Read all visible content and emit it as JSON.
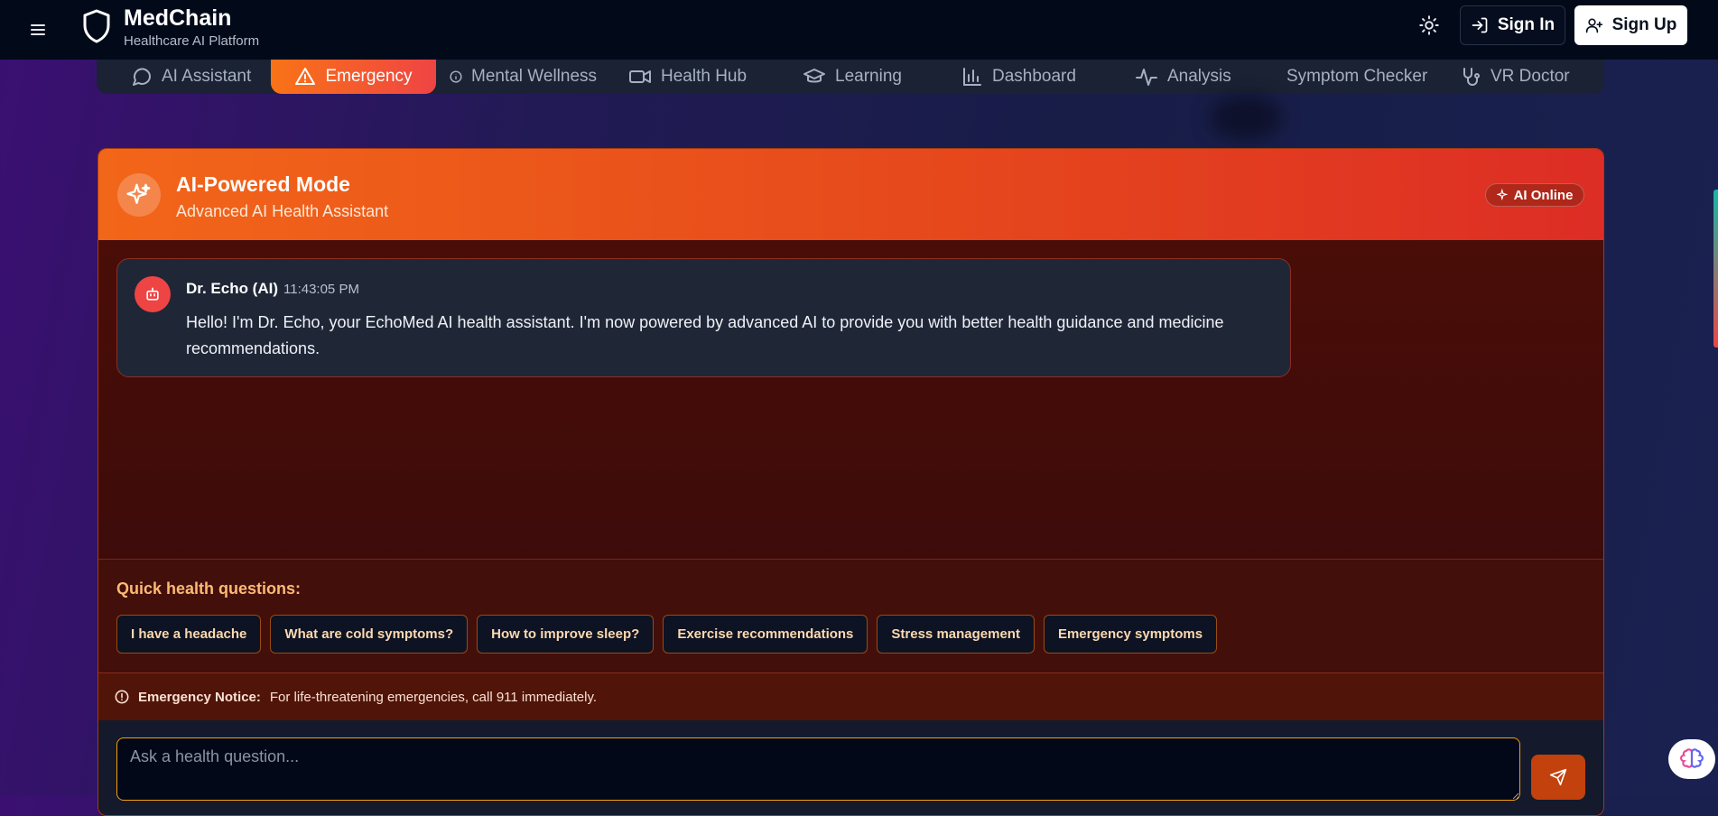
{
  "header": {
    "brand_name": "MedChain",
    "brand_subtitle": "Healthcare AI Platform",
    "sign_in_label": "Sign In",
    "sign_up_label": "Sign Up"
  },
  "nav": {
    "items": [
      {
        "label": "AI Assistant",
        "icon": "chat-bubble-icon"
      },
      {
        "label": "Emergency",
        "icon": "warning-triangle-icon",
        "active": true
      },
      {
        "label": "Mental Wellness",
        "icon": "info-icon"
      },
      {
        "label": "Health Hub",
        "icon": "video-icon"
      },
      {
        "label": "Learning",
        "icon": "graduation-cap-icon"
      },
      {
        "label": "Dashboard",
        "icon": "bar-chart-icon"
      },
      {
        "label": "Analysis",
        "icon": "activity-icon"
      },
      {
        "label": "Symptom Checker",
        "icon": ""
      },
      {
        "label": "VR Doctor",
        "icon": "stethoscope-icon"
      }
    ]
  },
  "chat": {
    "mode_title": "AI-Powered Mode",
    "mode_subtitle": "Advanced AI Health Assistant",
    "status_label": "AI Online",
    "message": {
      "sender": "Dr. Echo (AI)",
      "time": "11:43:05 PM",
      "text": "Hello! I'm Dr. Echo, your EchoMed AI health assistant. I'm now powered by advanced AI to provide you with better health guidance and medicine recommendations."
    },
    "quick_label": "Quick health questions:",
    "quick_questions": [
      "I have a headache",
      "What are cold symptoms?",
      "How to improve sleep?",
      "Exercise recommendations",
      "Stress management",
      "Emergency symptoms"
    ],
    "notice_label": "Emergency Notice:",
    "notice_text": "For life-threatening emergencies, call 911 immediately.",
    "input_placeholder": "Ask a health question..."
  },
  "colors": {
    "accent_orange": "#f97316",
    "accent_red": "#ef4444",
    "chip_text": "#fcd9b0"
  }
}
